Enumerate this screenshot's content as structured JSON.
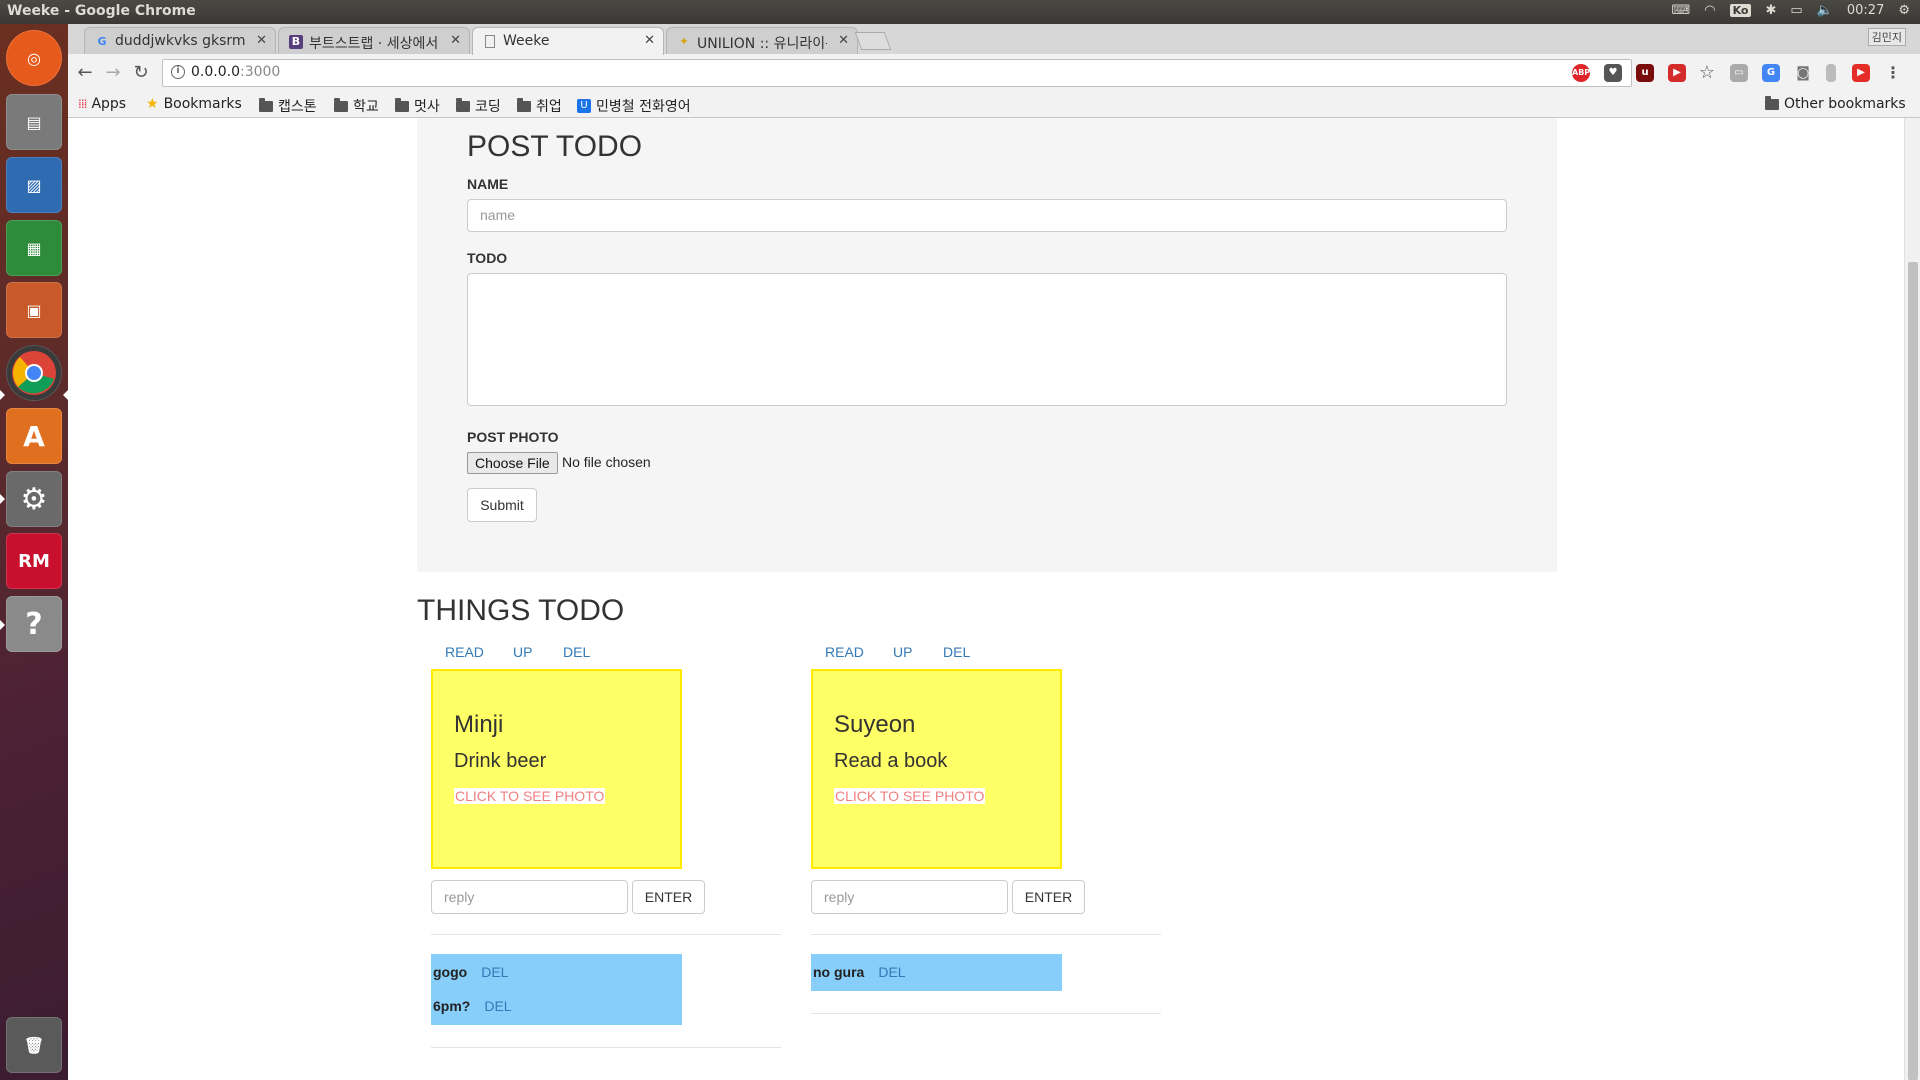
{
  "system": {
    "window_title": "Weeke - Google Chrome",
    "keyboard": "Ko",
    "clock": "00:27"
  },
  "browser": {
    "tabs": [
      {
        "title": "duddjwkvks gksrm",
        "favicon": "G"
      },
      {
        "title": "부트스트랩 · 세상에서",
        "favicon": "B"
      },
      {
        "title": "Weeke",
        "favicon": "doc"
      },
      {
        "title": "UNILION :: 유니라이온",
        "favicon": "lion"
      }
    ],
    "profile_label": "김민지",
    "url_host": "0.0.0.0",
    "url_port": ":3000",
    "bookmarks": [
      {
        "label": "Apps",
        "icon": "apps-grid-icon"
      },
      {
        "label": "Bookmarks",
        "icon": "star-icon"
      },
      {
        "label": "캡스톤",
        "icon": "folder-icon"
      },
      {
        "label": "학교",
        "icon": "folder-icon"
      },
      {
        "label": "멋사",
        "icon": "folder-icon"
      },
      {
        "label": "코딩",
        "icon": "folder-icon"
      },
      {
        "label": "취업",
        "icon": "folder-icon"
      },
      {
        "label": "민병철 전화영어",
        "icon": "u-badge-icon"
      }
    ],
    "other_bookmarks": "Other bookmarks"
  },
  "form": {
    "heading": "POST TODO",
    "name_label": "NAME",
    "name_placeholder": "name",
    "todo_label": "TODO",
    "photo_label": "POST PHOTO",
    "choose_file": "Choose File",
    "no_file": "No file chosen",
    "submit": "Submit"
  },
  "list": {
    "heading": "THINGS TODO",
    "actions": {
      "read": "READ",
      "up": "UP",
      "del": "DEL"
    },
    "photo_link": "CLICK TO SEE PHOTO",
    "reply_placeholder": "reply",
    "enter": "ENTER",
    "items": [
      {
        "name": "Minji",
        "todo": "Drink beer",
        "comments": [
          {
            "text": "gogo",
            "del": "DEL"
          },
          {
            "text": "6pm?",
            "del": "DEL"
          }
        ]
      },
      {
        "name": "Suyeon",
        "todo": "Read a book",
        "comments": [
          {
            "text": "no gura",
            "del": "DEL"
          }
        ]
      }
    ]
  },
  "colors": {
    "note_bg": "#ffff66",
    "note_border": "#ffea00",
    "comment_bg": "#87cefa",
    "link": "#337ab7",
    "photo_link": "#f08080"
  }
}
